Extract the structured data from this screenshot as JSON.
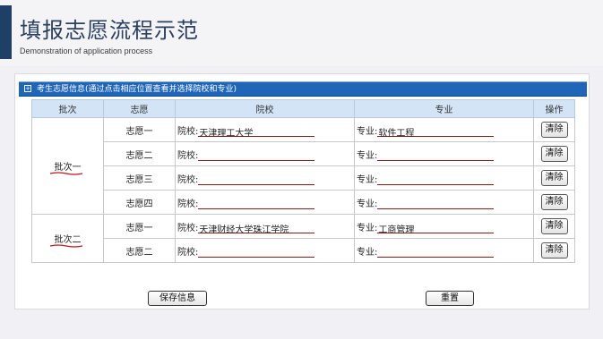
{
  "header": {
    "title": "填报志愿流程示范",
    "subtitle": "Demonstration of application process",
    "accent_color": "#1f3f66"
  },
  "section": {
    "label": "考生志愿信息(通过点击相应位置查看并选择院校和专业)",
    "icon": "plus-box-icon",
    "bar_color": "#1f66b8"
  },
  "table": {
    "headers": [
      "批次",
      "志愿",
      "院校",
      "专业",
      "操作"
    ],
    "school_prefix": "院校:",
    "major_prefix": "专业:",
    "delete_label": "清除",
    "batches": [
      {
        "label": "批次一",
        "rows": [
          {
            "choice": "志愿一",
            "school": "天津理工大学",
            "major": "软件工程"
          },
          {
            "choice": "志愿二",
            "school": "",
            "major": ""
          },
          {
            "choice": "志愿三",
            "school": "",
            "major": ""
          },
          {
            "choice": "志愿四",
            "school": "",
            "major": ""
          }
        ]
      },
      {
        "label": "批次二",
        "rows": [
          {
            "choice": "志愿一",
            "school": "天津财经大学珠江学院",
            "major": "工商管理"
          },
          {
            "choice": "志愿二",
            "school": "",
            "major": ""
          }
        ]
      }
    ]
  },
  "buttons": {
    "save": "保存信息",
    "reset": "重置"
  }
}
